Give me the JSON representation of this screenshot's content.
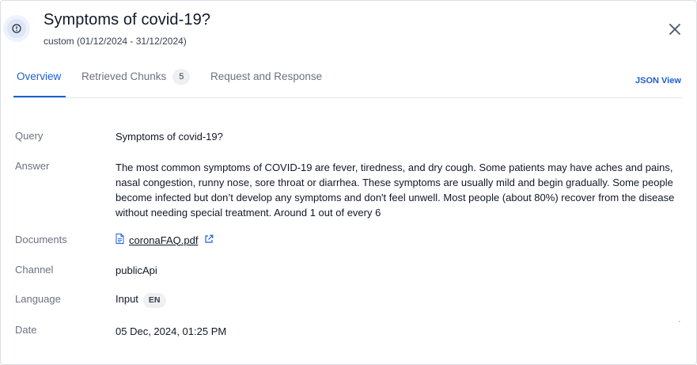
{
  "header": {
    "title": "Symptoms of covid-19?",
    "subtitle": "custom (01/12/2024 - 31/12/2024)",
    "icon": "info-circle-icon",
    "close_icon": "close-icon"
  },
  "tabs": [
    {
      "label": "Overview",
      "active": true
    },
    {
      "label": "Retrieved Chunks",
      "count": "5",
      "active": false
    },
    {
      "label": "Request and Response",
      "active": false
    }
  ],
  "json_view_label": "JSON View",
  "details": {
    "query": {
      "label": "Query",
      "value": "Symptoms of covid-19?"
    },
    "answer": {
      "label": "Answer",
      "value": "The most common symptoms of COVID-19 are fever, tiredness, and dry cough. Some patients may have aches and pains, nasal congestion, runny nose, sore throat or diarrhea. These symptoms are usually mild and begin gradually. Some people become infected but don’t develop any symptoms and don't feel unwell. Most people (about 80%) recover from the disease without needing special treatment. Around 1 out of every 6"
    },
    "documents": {
      "label": "Documents",
      "file": "coronaFAQ.pdf",
      "file_icon": "document-icon",
      "open_icon": "external-link-icon"
    },
    "channel": {
      "label": "Channel",
      "value": "publicApi"
    },
    "language": {
      "label": "Language",
      "value": "Input",
      "code": "EN"
    },
    "date": {
      "label": "Date",
      "value": "05 Dec, 2024, 01:25 PM"
    }
  },
  "colors": {
    "accent": "#1d5fd1",
    "muted_text": "#6b7280",
    "badge_bg": "#eef0f3"
  }
}
